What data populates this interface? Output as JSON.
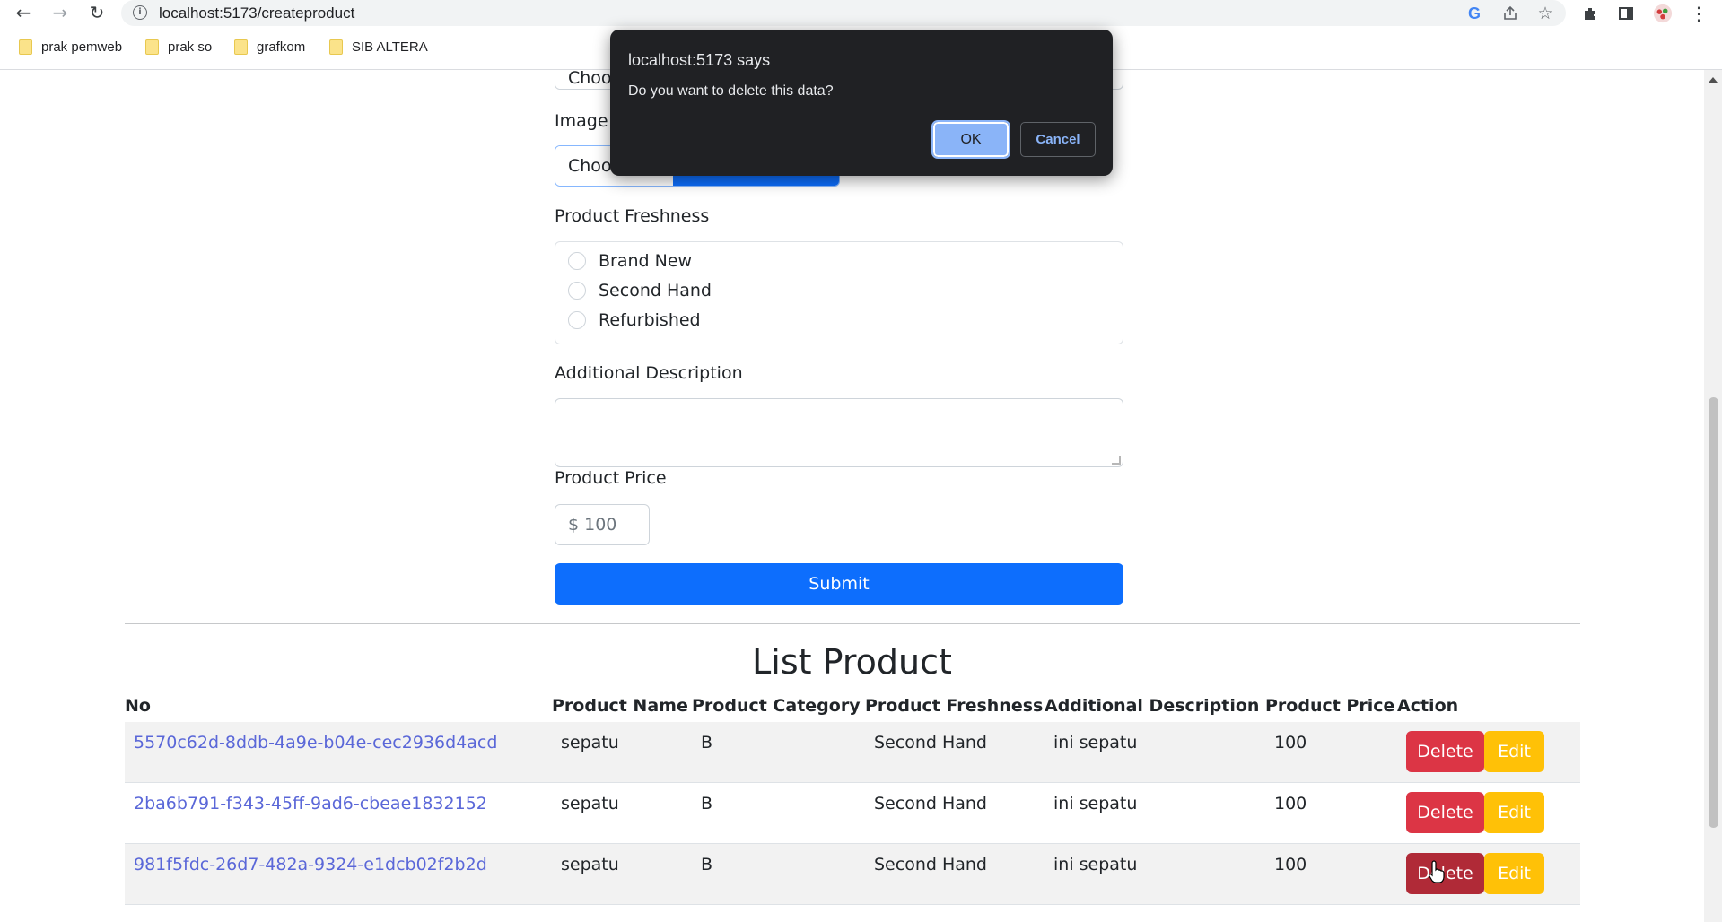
{
  "browser": {
    "url": "localhost:5173/createproduct",
    "bookmarks": [
      "prak pemweb",
      "prak so",
      "grafkom",
      "SIB ALTERA"
    ]
  },
  "form": {
    "file_button_partial_top": "Choo",
    "image_label_partial": "Image o",
    "file_button_partial": "Choo",
    "freshness_label": "Product Freshness",
    "freshness_options": [
      "Brand New",
      "Second Hand",
      "Refurbished"
    ],
    "description_label": "Additional Description",
    "price_label": "Product Price",
    "price_placeholder": "$ 100",
    "submit_label": "Submit"
  },
  "list": {
    "title": "List Product",
    "columns": [
      "No",
      "Product Name",
      "Product Category",
      "Product Freshness",
      "Additional Description",
      "Product Price",
      "Action"
    ],
    "rows": [
      {
        "id": "5570c62d-8ddb-4a9e-b04e-cec2936d4acd",
        "name": "sepatu",
        "category": "B",
        "freshness": "Second Hand",
        "description": "ini sepatu",
        "price": "100"
      },
      {
        "id": "2ba6b791-f343-45ff-9ad6-cbeae1832152",
        "name": "sepatu",
        "category": "B",
        "freshness": "Second Hand",
        "description": "ini sepatu",
        "price": "100"
      },
      {
        "id": "981f5fdc-26d7-482a-9324-e1dcb02f2b2d",
        "name": "sepatu",
        "category": "B",
        "freshness": "Second Hand",
        "description": "ini sepatu",
        "price": "100"
      }
    ],
    "delete_label": "Delete",
    "edit_label": "Edit"
  },
  "dialog": {
    "title": "localhost:5173 says",
    "message": "Do you want to delete this data?",
    "ok_label": "OK",
    "cancel_label": "Cancel"
  }
}
